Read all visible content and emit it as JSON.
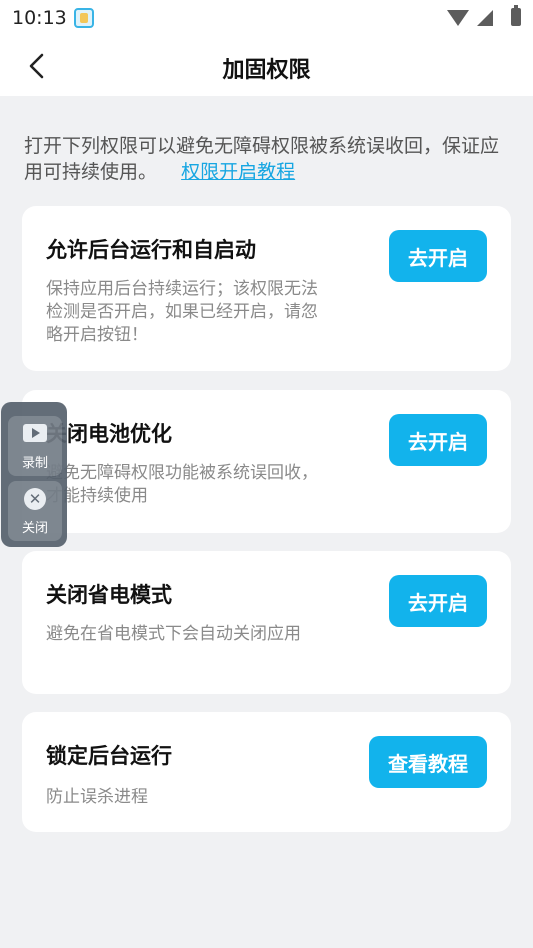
{
  "status_bar": {
    "time": "10:13",
    "icons": [
      "app-notification-icon",
      "wifi-icon",
      "signal-icon",
      "battery-charging-icon"
    ]
  },
  "header": {
    "back_icon": "chevron-left-icon",
    "title": "加固权限"
  },
  "intro": {
    "text": "打开下列权限可以避免无障碍权限被系统误收回，保证应用可持续使用。",
    "link": "权限开启教程",
    "link_color": "#17a6e2"
  },
  "cards": [
    {
      "title": "允许后台运行和自启动",
      "description": "保持应用后台持续运行；该权限无法检测是否开启，如果已经开启，请忽略开启按钮！",
      "button": "去开启"
    },
    {
      "title": "关闭电池优化",
      "description": "避免无障碍权限功能被系统误回收，才能持续使用",
      "button": "去开启"
    },
    {
      "title": "关闭省电模式",
      "description": "避免在省电模式下会自动关闭应用",
      "button": "去开启"
    },
    {
      "title": "锁定后台运行",
      "description": "防止误杀进程",
      "button": "查看教程"
    }
  ],
  "floating_panel": {
    "record_label": "录制",
    "close_label": "关闭"
  },
  "colors": {
    "accent": "#12b3ec",
    "background": "#f0f1f3",
    "card": "#ffffff"
  }
}
